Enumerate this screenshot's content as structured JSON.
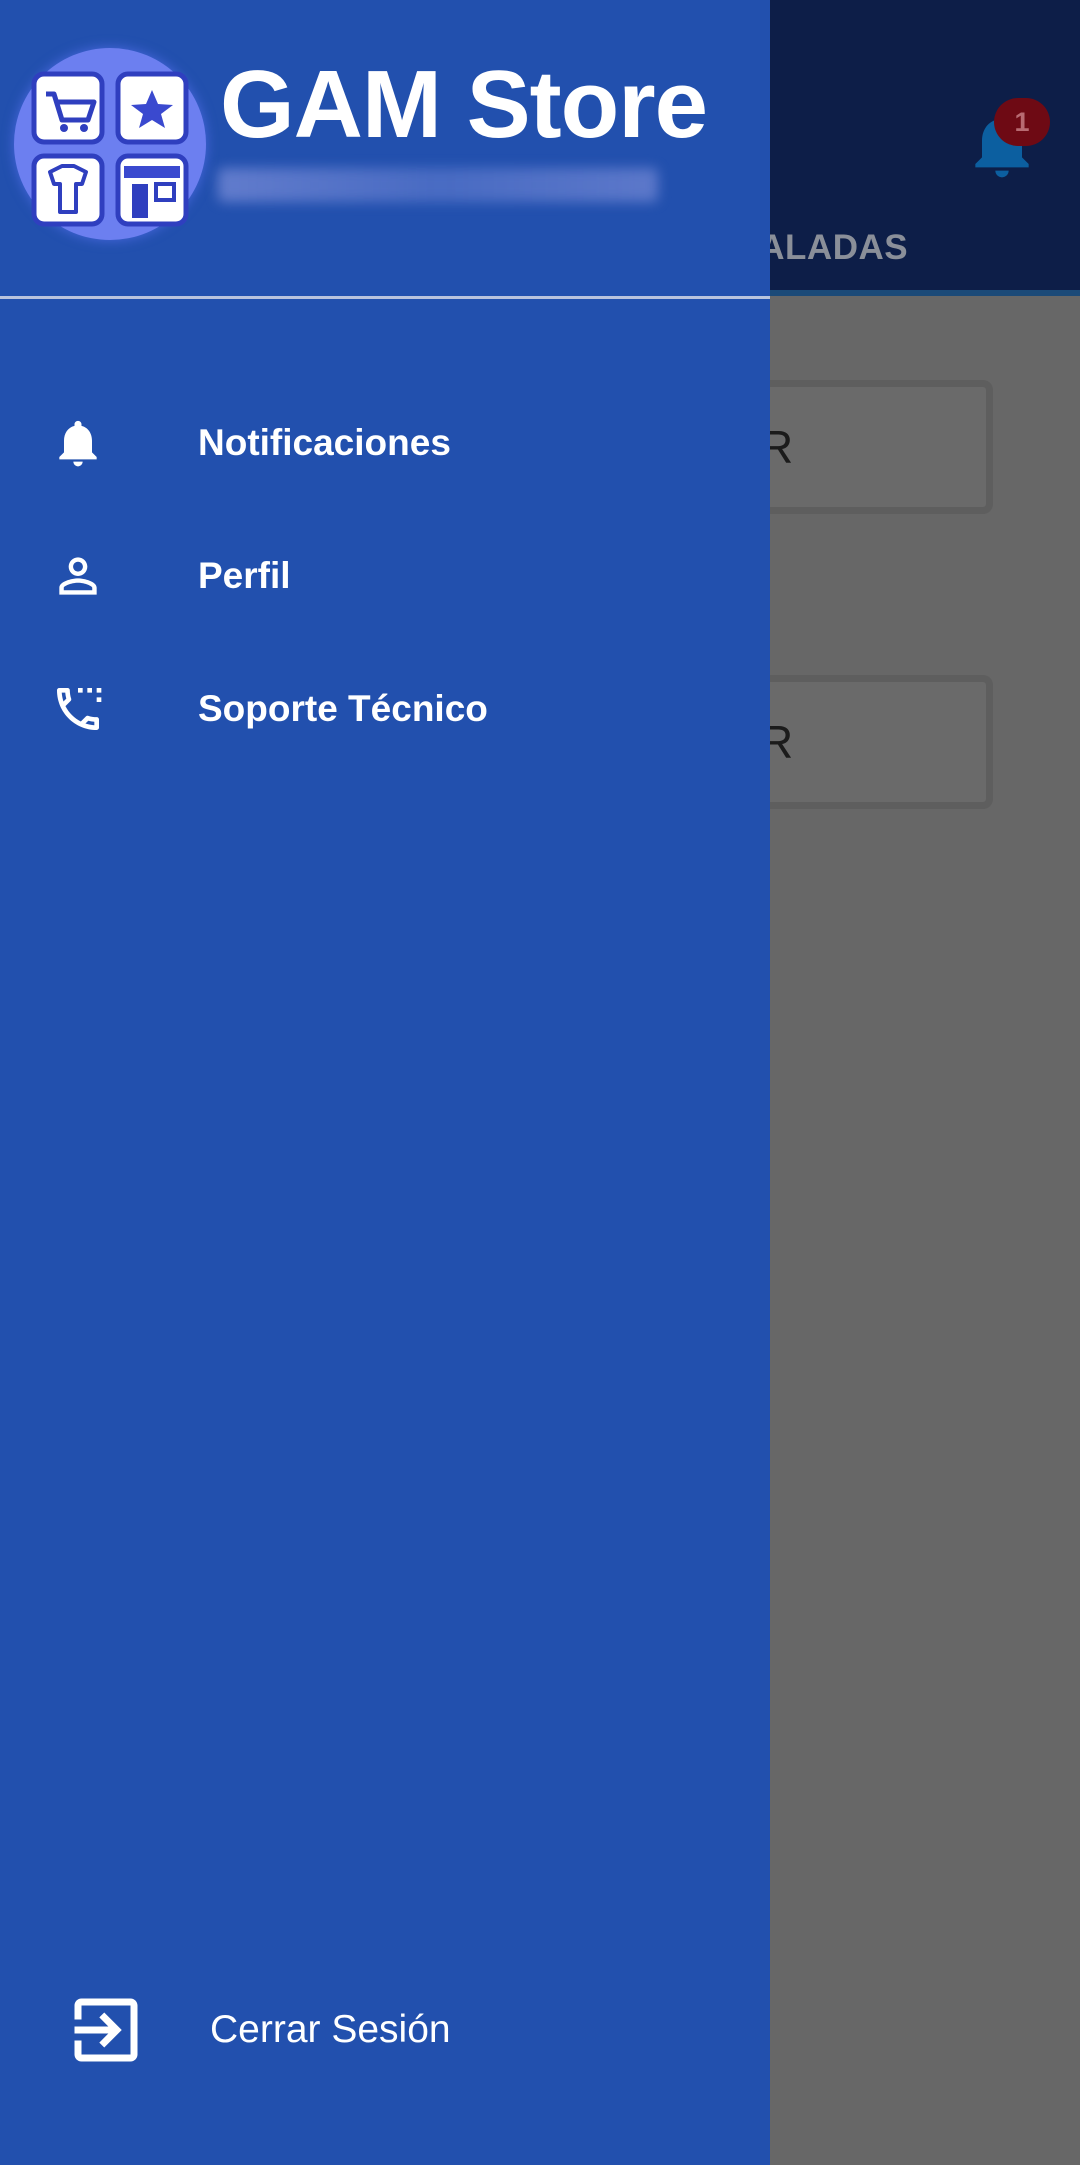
{
  "background": {
    "tab_label": "TALADAS",
    "notification_badge": "1",
    "cards": [
      {
        "label": "R"
      },
      {
        "label": "R"
      }
    ]
  },
  "drawer": {
    "app_title": "GAM Store",
    "subtitle": "",
    "menu": [
      {
        "label": "Notificaciones",
        "icon": "bell-icon"
      },
      {
        "label": "Perfil",
        "icon": "person-icon"
      },
      {
        "label": "Soporte Técnico",
        "icon": "phone-dialpad-icon"
      }
    ],
    "logout_label": "Cerrar Sesión"
  },
  "colors": {
    "drawer_bg": "#2250ae",
    "appbar_bg": "#0d1e48",
    "scrim_bg": "#676767",
    "badge_bg": "#6e0a14"
  }
}
